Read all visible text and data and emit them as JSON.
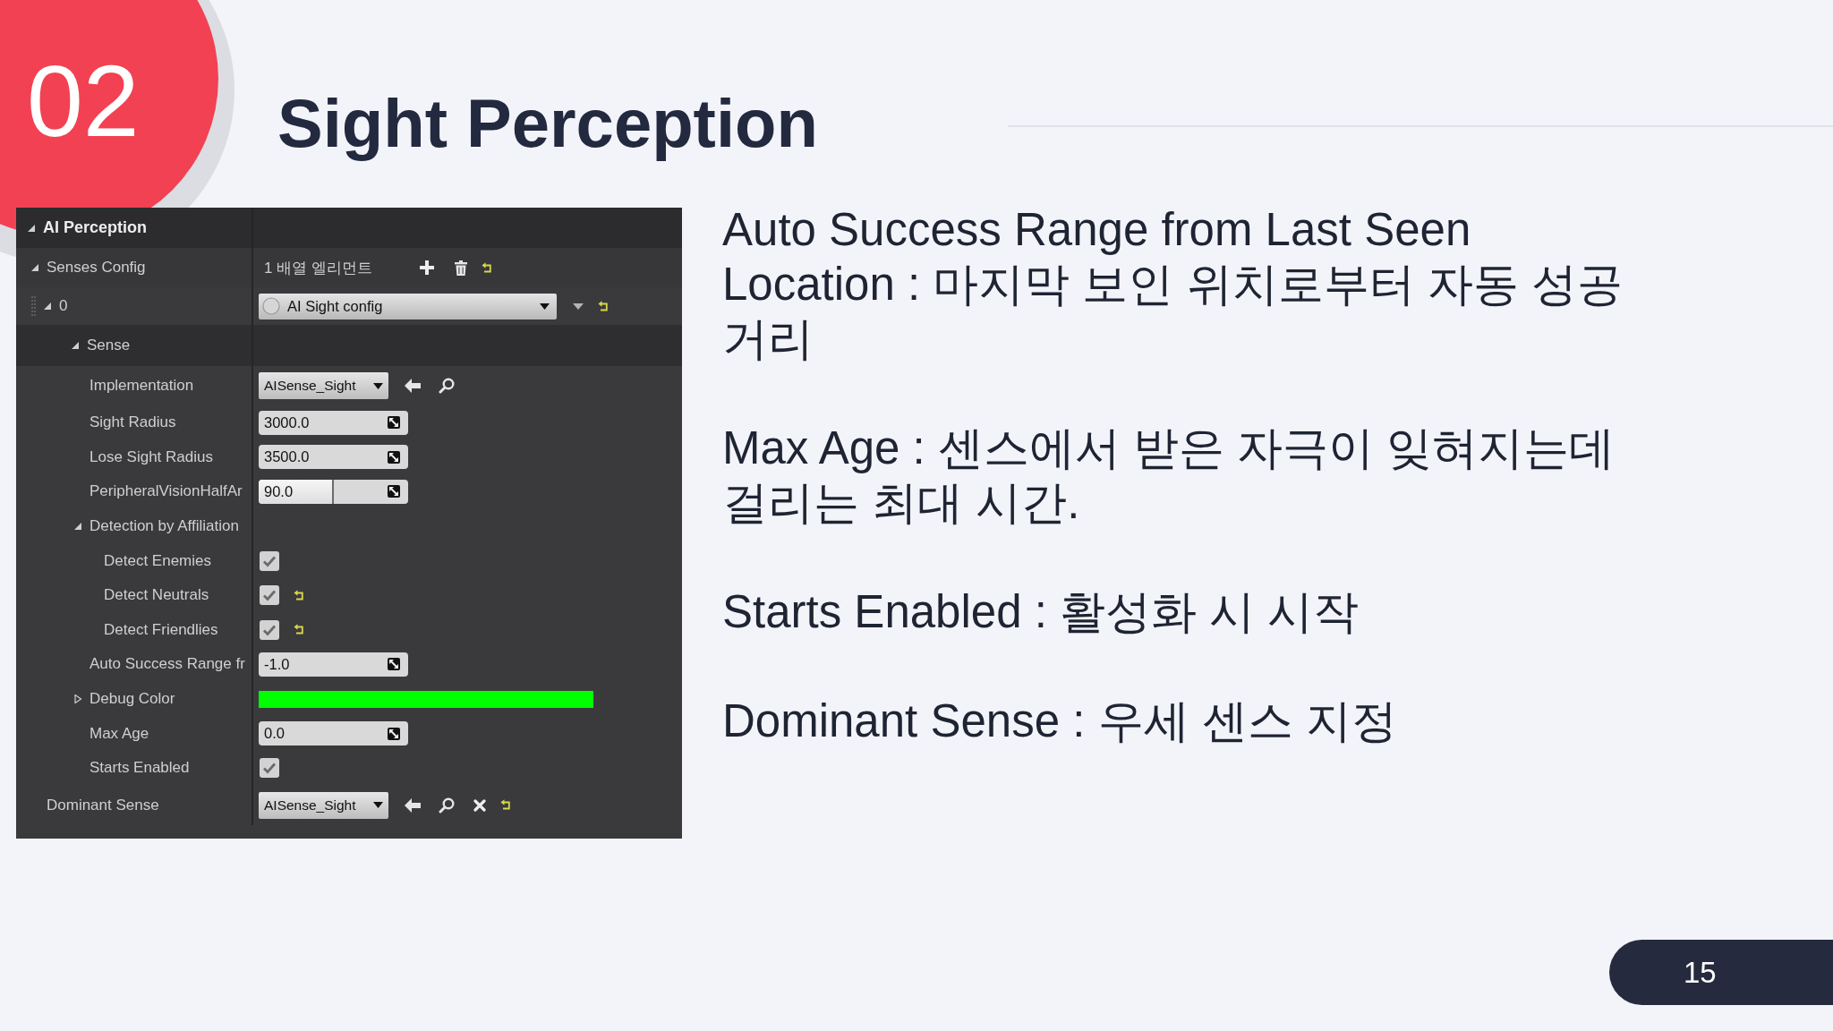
{
  "slide": {
    "section_number": "02",
    "title": "Sight Perception",
    "page_number": "15"
  },
  "details_panel": {
    "header": {
      "label": "AI Perception",
      "expanded": true
    },
    "properties": [
      {
        "kind": "array",
        "label": "Senses Config",
        "expanded": true,
        "value": "1 배열 엘리먼트",
        "reset": true,
        "children": [
          {
            "kind": "element",
            "label": "0",
            "expanded": true,
            "value": "AI Sight config",
            "reset": true,
            "children": [
              {
                "kind": "category",
                "label": "Sense",
                "expanded": true,
                "children": [
                  {
                    "kind": "asset",
                    "label": "Implementation",
                    "value": "AISense_Sight",
                    "clear": false,
                    "reset": false
                  },
                  {
                    "kind": "number",
                    "label": "Sight Radius",
                    "value": "3000.0",
                    "reset": false
                  },
                  {
                    "kind": "number",
                    "label": "Lose Sight Radius",
                    "value": "3500.0",
                    "reset": false
                  },
                  {
                    "kind": "number",
                    "label": "PeripheralVisionHalfAr",
                    "value": "90.0",
                    "level": 0.5,
                    "reset": false
                  },
                  {
                    "kind": "struct",
                    "label": "Detection by Affiliation",
                    "expanded": true,
                    "children": [
                      {
                        "kind": "checkbox",
                        "label": "Detect Enemies",
                        "checked": true,
                        "reset": false
                      },
                      {
                        "kind": "checkbox",
                        "label": "Detect Neutrals",
                        "checked": true,
                        "reset": true
                      },
                      {
                        "kind": "checkbox",
                        "label": "Detect Friendlies",
                        "checked": true,
                        "reset": true
                      }
                    ]
                  },
                  {
                    "kind": "number",
                    "label": "Auto Success Range fr",
                    "value": "-1.0",
                    "reset": false
                  },
                  {
                    "kind": "color",
                    "label": "Debug Color",
                    "expanded": false,
                    "color": "#00ff00",
                    "reset": false
                  },
                  {
                    "kind": "number",
                    "label": "Max Age",
                    "value": "0.0",
                    "reset": false
                  },
                  {
                    "kind": "checkbox",
                    "label": "Starts Enabled",
                    "checked": true,
                    "reset": false
                  }
                ]
              }
            ]
          }
        ]
      },
      {
        "kind": "asset",
        "label": "Dominant Sense",
        "value": "AISense_Sight",
        "clear": true,
        "reset": true
      }
    ]
  },
  "notes": [
    "Auto Success Range from Last Seen Location : 마지막 보인 위치로부터 자동 성공 거리",
    "Max Age : 센스에서 받은 자극이 잊혀지는데 걸리는 최대 시간.",
    "Starts Enabled : 활성화 시 시작",
    "Dominant Sense : 우세 센스 지정"
  ]
}
